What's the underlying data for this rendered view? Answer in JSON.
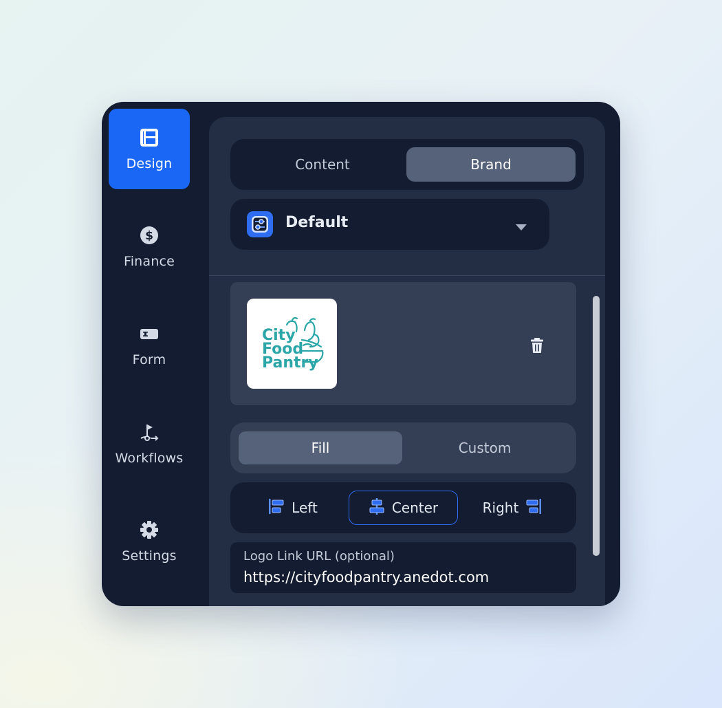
{
  "sidebar": {
    "items": [
      {
        "label": "Design",
        "icon": "layout-icon",
        "active": true
      },
      {
        "label": "Finance",
        "icon": "dollar-icon",
        "active": false
      },
      {
        "label": "Form",
        "icon": "input-field-icon",
        "active": false
      },
      {
        "label": "Workflows",
        "icon": "workflow-icon",
        "active": false
      },
      {
        "label": "Settings",
        "icon": "gear-icon",
        "active": false
      }
    ]
  },
  "tabs": {
    "content_label": "Content",
    "brand_label": "Brand",
    "selected": "Brand"
  },
  "preset": {
    "label": "Default",
    "icon": "sliders-icon"
  },
  "logo": {
    "text_line1": "City",
    "text_line2": "Food",
    "text_line3": "Pantry",
    "color": "#2aa6a8"
  },
  "fill_mode": {
    "fill_label": "Fill",
    "custom_label": "Custom",
    "selected": "Fill"
  },
  "alignment": {
    "left_label": "Left",
    "center_label": "Center",
    "right_label": "Right",
    "selected": "Center"
  },
  "logo_link": {
    "label": "Logo Link URL (optional)",
    "value": "https://cityfoodpantry.anedot.com"
  },
  "colors": {
    "accent": "#1a66f5",
    "app_bg": "#131c30",
    "panel_bg": "#232e44"
  }
}
